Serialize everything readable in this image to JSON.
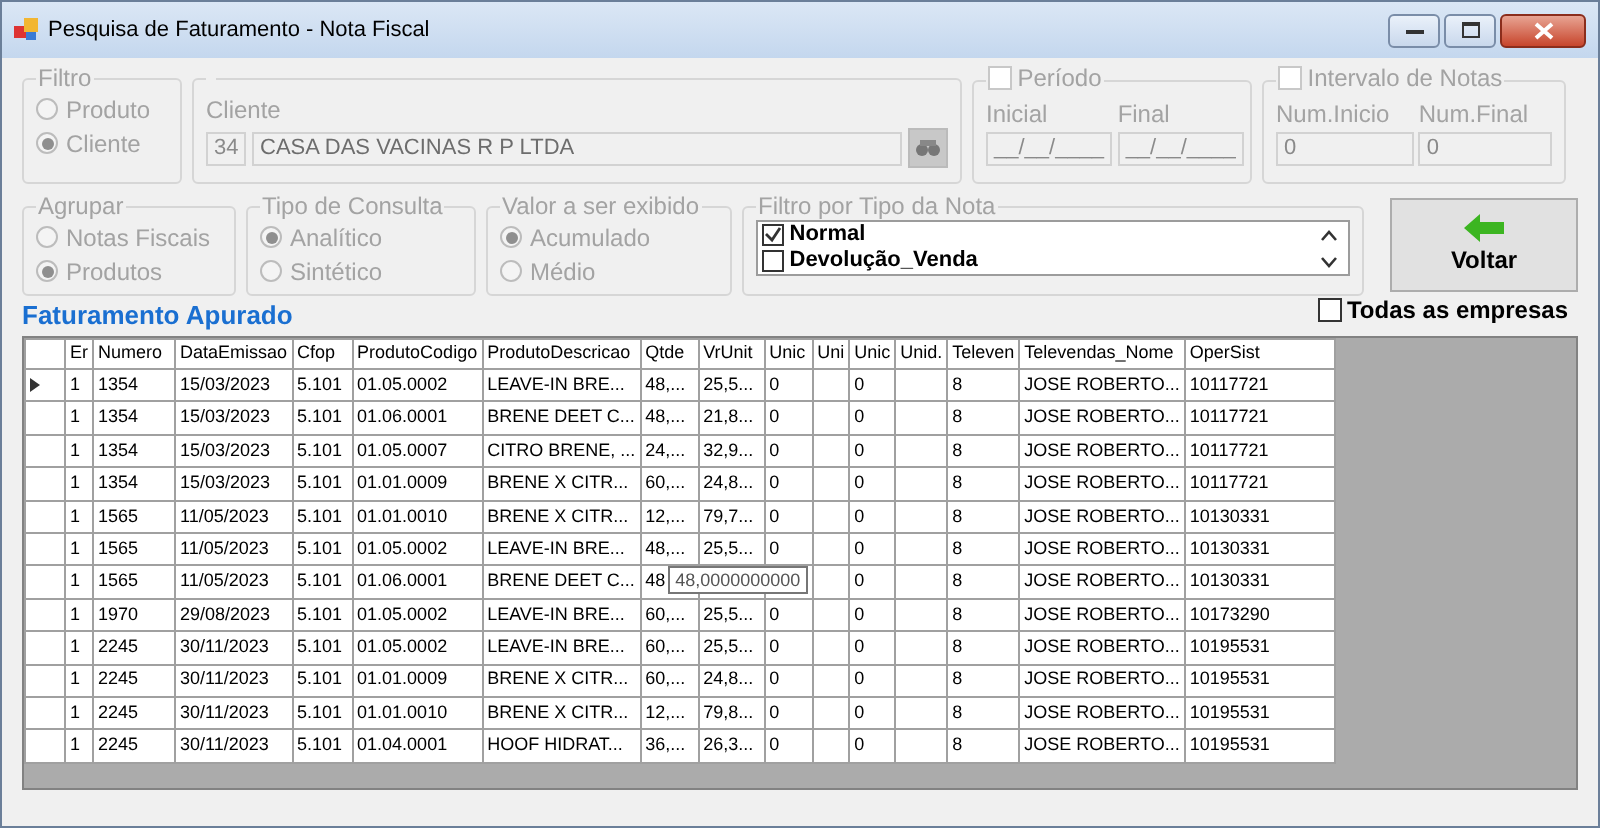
{
  "window": {
    "title": "Pesquisa de Faturamento - Nota Fiscal"
  },
  "filtro": {
    "title": "Filtro",
    "disabled": true,
    "options": [
      {
        "label": "Produto",
        "selected": false
      },
      {
        "label": "Cliente",
        "selected": true
      }
    ]
  },
  "cliente": {
    "title": "Cliente",
    "disabled": true,
    "code": "34",
    "name": "CASA DAS VACINAS R P LTDA"
  },
  "periodo": {
    "title": "Período",
    "checked": false,
    "disabled": true,
    "fields": [
      {
        "label": "Inicial",
        "value": "__/__/____"
      },
      {
        "label": "Final",
        "value": "__/__/____"
      }
    ]
  },
  "intervalo": {
    "title": "Intervalo de Notas",
    "checked": false,
    "disabled": true,
    "fields": [
      {
        "label": "Num.Inicio",
        "value": "0"
      },
      {
        "label": "Num.Final",
        "value": "0"
      }
    ]
  },
  "agrupar": {
    "title": "Agrupar",
    "disabled": true,
    "options": [
      {
        "label": "Notas Fiscais",
        "selected": false
      },
      {
        "label": "Produtos",
        "selected": true
      }
    ]
  },
  "tipo_consulta": {
    "title": "Tipo de Consulta",
    "disabled": true,
    "options": [
      {
        "label": "Analítico",
        "selected": true
      },
      {
        "label": "Sintético",
        "selected": false
      }
    ]
  },
  "valor_exibido": {
    "title": "Valor a ser exibido",
    "disabled": true,
    "options": [
      {
        "label": "Acumulado",
        "selected": true
      },
      {
        "label": "Médio",
        "selected": false
      }
    ]
  },
  "filtro_tipo_nota": {
    "title": "Filtro por Tipo da Nota",
    "items": [
      {
        "label": "Normal",
        "checked": true
      },
      {
        "label": "Devolução_Venda",
        "checked": false
      }
    ]
  },
  "voltar_button": {
    "label": "Voltar"
  },
  "todas_empresas": {
    "label": "Todas as empresas",
    "checked": false
  },
  "section_title": "Faturamento Apurado",
  "table": {
    "columns": [
      "Er",
      "Numero",
      "DataEmissao",
      "Cfop",
      "ProdutoCodigo",
      "ProdutoDescricao",
      "Qtde",
      "VrUnit",
      "Unic",
      "Uni",
      "Unic",
      "Unid.",
      "Televen",
      "Televendas_Nome",
      "OperSist"
    ],
    "rows": [
      {
        "current": true,
        "cells": [
          "1",
          "1354",
          "15/03/2023",
          "5.101",
          "01.05.0002",
          "LEAVE-IN BRE...",
          "48,...",
          "25,5...",
          "0",
          null,
          "0",
          null,
          "8",
          "JOSE ROBERTO...",
          "10117721"
        ]
      },
      {
        "current": false,
        "cells": [
          "1",
          "1354",
          "15/03/2023",
          "5.101",
          "01.06.0001",
          "BRENE DEET C...",
          "48,...",
          "21,8...",
          "0",
          null,
          "0",
          null,
          "8",
          "JOSE ROBERTO...",
          "10117721"
        ]
      },
      {
        "current": false,
        "cells": [
          "1",
          "1354",
          "15/03/2023",
          "5.101",
          "01.05.0007",
          "CITRO BRENE, ...",
          "24,...",
          "32,9...",
          "0",
          null,
          "0",
          null,
          "8",
          "JOSE ROBERTO...",
          "10117721"
        ]
      },
      {
        "current": false,
        "cells": [
          "1",
          "1354",
          "15/03/2023",
          "5.101",
          "01.01.0009",
          "BRENE X CITR...",
          "60,...",
          "24,8...",
          "0",
          null,
          "0",
          null,
          "8",
          "JOSE ROBERTO...",
          "10117721"
        ]
      },
      {
        "current": false,
        "cells": [
          "1",
          "1565",
          "11/05/2023",
          "5.101",
          "01.01.0010",
          "BRENE X CITR...",
          "12,...",
          "79,7...",
          "0",
          null,
          "0",
          null,
          "8",
          "JOSE ROBERTO...",
          "10130331"
        ]
      },
      {
        "current": false,
        "cells": [
          "1",
          "1565",
          "11/05/2023",
          "5.101",
          "01.05.0002",
          "LEAVE-IN BRE...",
          "48,...",
          "25,5...",
          "0",
          null,
          "0",
          null,
          "8",
          "JOSE ROBERTO...",
          "10130331"
        ]
      },
      {
        "current": false,
        "cells": [
          "1",
          "1565",
          "11/05/2023",
          "5.101",
          "01.06.0001",
          "BRENE DEET C...",
          "48",
          null,
          null,
          null,
          "0",
          null,
          "8",
          "JOSE ROBERTO...",
          "10130331"
        ],
        "tooltip": "48,0000000000"
      },
      {
        "current": false,
        "cells": [
          "1",
          "1970",
          "29/08/2023",
          "5.101",
          "01.05.0002",
          "LEAVE-IN BRE...",
          "60,...",
          "25,5...",
          "0",
          null,
          "0",
          null,
          "8",
          "JOSE ROBERTO...",
          "10173290"
        ]
      },
      {
        "current": false,
        "cells": [
          "1",
          "2245",
          "30/11/2023",
          "5.101",
          "01.05.0002",
          "LEAVE-IN BRE...",
          "60,...",
          "25,5...",
          "0",
          null,
          "0",
          null,
          "8",
          "JOSE ROBERTO...",
          "10195531"
        ]
      },
      {
        "current": false,
        "cells": [
          "1",
          "2245",
          "30/11/2023",
          "5.101",
          "01.01.0009",
          "BRENE X CITR...",
          "60,...",
          "24,8...",
          "0",
          null,
          "0",
          null,
          "8",
          "JOSE ROBERTO...",
          "10195531"
        ]
      },
      {
        "current": false,
        "cells": [
          "1",
          "2245",
          "30/11/2023",
          "5.101",
          "01.01.0010",
          "BRENE X CITR...",
          "12,...",
          "79,8...",
          "0",
          null,
          "0",
          null,
          "8",
          "JOSE ROBERTO...",
          "10195531"
        ]
      },
      {
        "current": false,
        "cells": [
          "1",
          "2245",
          "30/11/2023",
          "5.101",
          "01.04.0001",
          "HOOF HIDRAT...",
          "36,...",
          "26,3...",
          "0",
          null,
          "0",
          null,
          "8",
          "JOSE ROBERTO...",
          "10195531"
        ]
      }
    ]
  }
}
